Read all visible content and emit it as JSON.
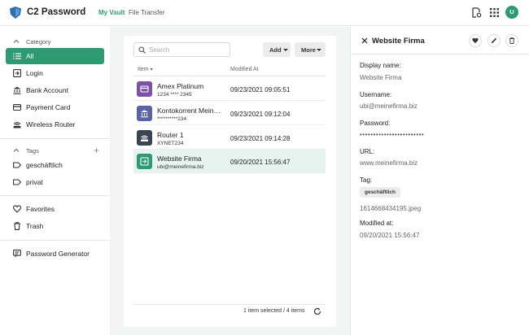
{
  "header": {
    "app_title": "C2 Password",
    "tabs": [
      {
        "label": "My Vault",
        "active": true
      },
      {
        "label": "File Transfer",
        "active": false
      }
    ],
    "icons": [
      "document-settings-icon",
      "apps-grid-icon"
    ],
    "avatar_initial": "U"
  },
  "sidebar": {
    "category_label": "Category",
    "categories": [
      {
        "label": "All",
        "icon": "list-icon",
        "active": true
      },
      {
        "label": "Login",
        "icon": "login-icon"
      },
      {
        "label": "Bank Account",
        "icon": "bank-icon"
      },
      {
        "label": "Payment Card",
        "icon": "card-icon"
      },
      {
        "label": "Wireless Router",
        "icon": "wifi-icon"
      }
    ],
    "tags_label": "Tags",
    "tags": [
      {
        "label": "geschäftlich",
        "icon": "tag-icon"
      },
      {
        "label": "privat",
        "icon": "tag-icon"
      }
    ],
    "favorites_label": "Favorites",
    "trash_label": "Trash",
    "generator_label": "Password Generator"
  },
  "list": {
    "search_placeholder": "Search",
    "add_label": "Add",
    "more_label": "More",
    "col_item": "Item",
    "col_modified": "Modified At",
    "rows": [
      {
        "name": "Amex Platinum",
        "sub": "1234 **** 2345",
        "date": "09/23/2021 09:05:51",
        "color": "#7b52a6",
        "icon": "card-icon"
      },
      {
        "name": "Kontokorrent Meinebank",
        "sub": "**********234",
        "date": "09/23/2021 09:12:04",
        "color": "#5a62a8",
        "icon": "bank-icon"
      },
      {
        "name": "Router 1",
        "sub": "XYNET234",
        "date": "09/23/2021 09:14:28",
        "color": "#3b4452",
        "icon": "wifi-icon"
      },
      {
        "name": "Website Firma",
        "sub": "ubi@meinefirma.biz",
        "date": "09/20/2021 15:56:47",
        "color": "#2e9a74",
        "icon": "login-icon",
        "selected": true
      }
    ],
    "footer_status": "1 item selected / 4 items"
  },
  "detail": {
    "title": "Website Firma",
    "display_name_label": "Display name:",
    "display_name": "Website Firma",
    "username_label": "Username:",
    "username": "ubi@meinefirma.biz",
    "password_label": "Password:",
    "password": "••••••••••••••••••••••••",
    "url_label": "URL:",
    "url": "www.meinefirma.biz",
    "tag_label": "Tag:",
    "tag": "geschäftlich",
    "attachment": "1614668434195.jpeg",
    "modified_label": "Modified at:",
    "modified": "09/20/2021 15:56:47"
  },
  "colors": {
    "accent": "#2e9a74",
    "selected_row": "#e7f3ee"
  }
}
